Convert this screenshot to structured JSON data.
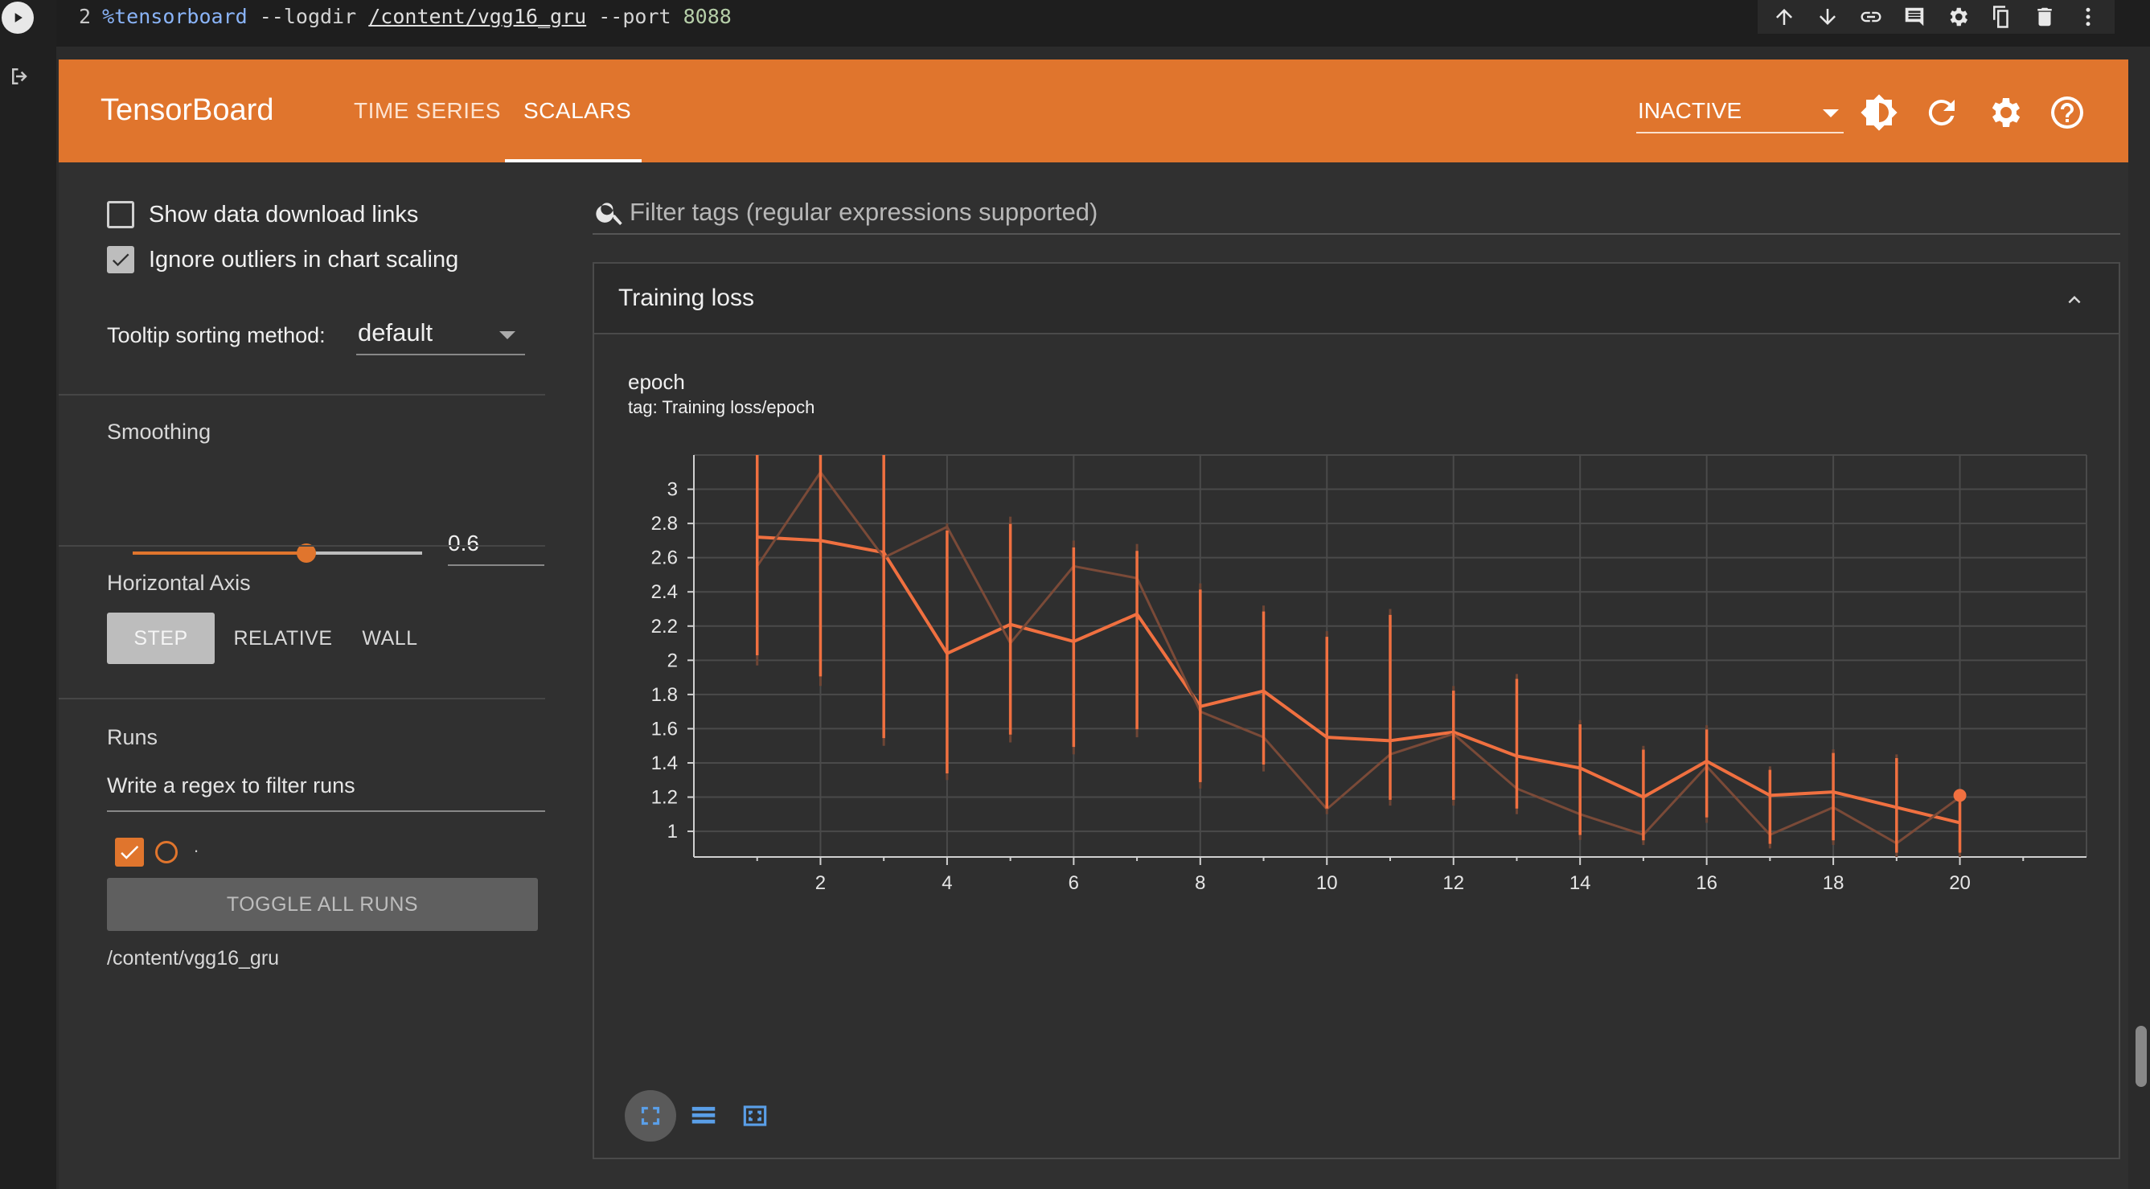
{
  "cell": {
    "line_number": "2",
    "magic": "%tensorboard",
    "arg_logdir": "--logdir",
    "logdir_path": "/content/vgg16_gru",
    "arg_port": "--port",
    "port": "8088"
  },
  "cell_toolbar_icons": [
    "arrow-up-icon",
    "arrow-down-icon",
    "link-icon",
    "comment-icon",
    "gear-icon",
    "mirror-cell-icon",
    "trash-icon",
    "more-vert-icon"
  ],
  "tensorboard": {
    "logo": "TensorBoard",
    "tabs": [
      {
        "label": "TIME SERIES",
        "active": false
      },
      {
        "label": "SCALARS",
        "active": true
      }
    ],
    "status": "INACTIVE",
    "header_icons": [
      "theme-toggle-icon",
      "refresh-icon",
      "settings-icon",
      "help-icon"
    ],
    "brand_color": "#e0752d"
  },
  "sidebar": {
    "show_download_links": {
      "label": "Show data download links",
      "checked": false
    },
    "ignore_outliers": {
      "label": "Ignore outliers in chart scaling",
      "checked": true
    },
    "tooltip_sorting": {
      "label": "Tooltip sorting method:",
      "value": "default"
    },
    "smoothing": {
      "title": "Smoothing",
      "value": "0.6",
      "fraction": 0.6
    },
    "horizontal_axis": {
      "title": "Horizontal Axis",
      "options": [
        "STEP",
        "RELATIVE",
        "WALL"
      ],
      "selected": "STEP"
    },
    "runs": {
      "title": "Runs",
      "filter_placeholder": "Write a regex to filter runs",
      "run_label": ".",
      "toggle_all": "TOGGLE ALL RUNS",
      "run_path": "/content/vgg16_gru"
    }
  },
  "main": {
    "filter_placeholder": "Filter tags (regular expressions supported)",
    "group_title": "Training loss"
  },
  "chart_data": {
    "type": "line",
    "title": "epoch",
    "subtitle": "tag: Training loss/epoch",
    "x_ticks": [
      2,
      4,
      6,
      8,
      10,
      12,
      14,
      16,
      18,
      20
    ],
    "y_ticks": [
      1,
      1.2,
      1.4,
      1.6,
      1.8,
      2,
      2.2,
      2.4,
      2.6,
      2.8,
      3
    ],
    "xlim": [
      0,
      22
    ],
    "ylim": [
      0.85,
      3.2
    ],
    "grid": true,
    "series": [
      {
        "smoothed": true,
        "color": "#f07040",
        "x": [
          1,
          2,
          3,
          4,
          5,
          6,
          7,
          8,
          9,
          10,
          11,
          12,
          13,
          14,
          15,
          16,
          17,
          18,
          19,
          20
        ],
        "y": [
          2.72,
          2.7,
          2.63,
          2.04,
          2.21,
          2.11,
          2.27,
          1.73,
          1.82,
          1.55,
          1.53,
          1.58,
          1.44,
          1.37,
          1.2,
          1.41,
          1.21,
          1.23,
          1.14,
          1.05
        ]
      },
      {
        "smoothed": false,
        "color": "#7a4a38",
        "x": [
          1,
          2,
          3,
          4,
          5,
          6,
          7,
          8,
          9,
          10,
          11,
          12,
          13,
          14,
          15,
          16,
          17,
          18,
          19,
          20
        ],
        "y": [
          2.55,
          3.1,
          2.6,
          2.78,
          2.1,
          2.55,
          2.48,
          1.7,
          1.55,
          1.13,
          1.45,
          1.57,
          1.25,
          1.1,
          0.98,
          1.38,
          0.98,
          1.14,
          0.93,
          1.2
        ]
      }
    ],
    "noise_range": {
      "x": [
        1,
        2,
        3,
        4,
        5,
        6,
        7,
        8,
        9,
        10,
        11,
        12,
        13,
        14,
        15,
        16,
        17,
        18,
        19,
        20
      ],
      "low": [
        1.97,
        1.85,
        1.5,
        1.3,
        1.52,
        1.45,
        1.55,
        1.25,
        1.35,
        1.1,
        1.15,
        1.15,
        1.1,
        0.95,
        0.92,
        1.05,
        0.9,
        0.92,
        0.85,
        0.85
      ],
      "high": [
        3.3,
        3.3,
        3.3,
        2.8,
        2.84,
        2.7,
        2.68,
        2.45,
        2.32,
        2.17,
        2.3,
        1.85,
        1.92,
        1.65,
        1.5,
        1.62,
        1.38,
        1.48,
        1.45,
        1.22
      ]
    },
    "last_point": {
      "x": 20,
      "y": 1.21
    },
    "controls": [
      "fullscreen-icon",
      "data-table-icon",
      "fit-domain-icon"
    ]
  }
}
